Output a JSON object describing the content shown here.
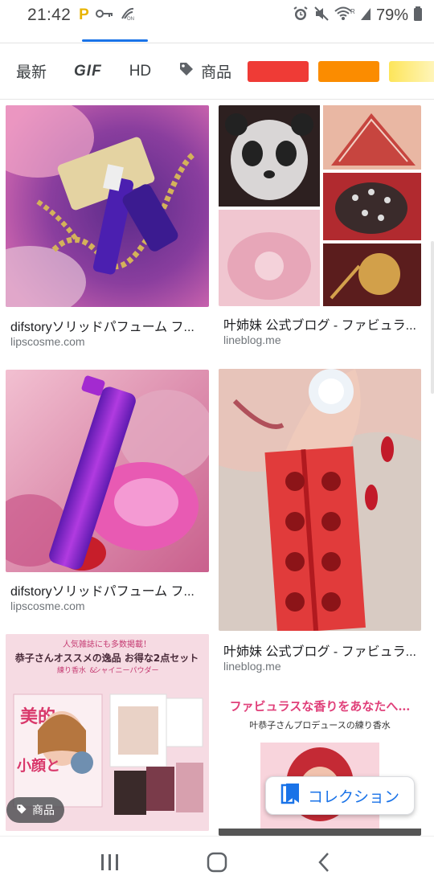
{
  "status_bar": {
    "time": "21:42",
    "battery": "79%"
  },
  "filters": {
    "items": [
      "最新",
      "GIF",
      "HD"
    ],
    "product_label": "商品",
    "color_swatches": [
      "#ef3b36",
      "#fb8c00",
      "#fde55a"
    ]
  },
  "results": [
    {
      "title": "difstoryソリッドパフューム フ...",
      "domain": "lipscosme.com"
    },
    {
      "title": "叶姉妹 公式ブログ - ファビュラ...",
      "domain": "lineblog.me"
    },
    {
      "title": "difstoryソリッドパフューム フ...",
      "domain": "lipscosme.com"
    },
    {
      "title": "叶姉妹 公式ブログ - ファビュラ...",
      "domain": "lineblog.me"
    },
    {
      "title": "",
      "domain": ""
    },
    {
      "title": "",
      "domain": ""
    }
  ],
  "image_text": {
    "magazine_banner": "人気雑誌にも多数掲載！",
    "magazine_headline": "恭子さんオススメの逸品 お得な2点セット",
    "magazine_sub1": "練り香水",
    "magazine_amp": "&",
    "magazine_sub2": "シャイニーパウダー",
    "magazine_cover_title": "美的",
    "magazine_cover_text": "小顔と",
    "fabulous_title": "ファビュラスな香りをあなたへ…",
    "fabulous_sub": "叶恭子さんプロデュースの練り香水"
  },
  "overlay": {
    "product_badge": "商品",
    "collection_button": "コレクション"
  },
  "colors": {
    "accent": "#1a73e8"
  }
}
